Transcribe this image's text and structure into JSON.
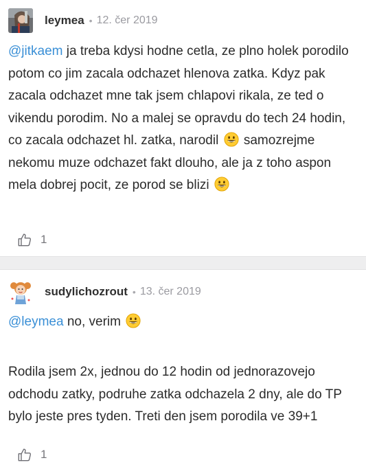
{
  "posts": [
    {
      "username": "leymea",
      "separator": "•",
      "date": "12. čer 2019",
      "mention": "@jitkaem",
      "text_part1": " ja treba kdysi hodne cetla, ze plno holek porodilo potom co jim zacala odchazet hlenova zatka. Kdyz pak zacala odchazet mne tak jsem chlapovi rikala, ze ted o vikendu porodim. No a malej se opravdu do tech 24 hodin, co zacala odchazet hl. zatka, narodil",
      "text_part2": " samozrejme nekomu muze odchazet fakt dlouho, ale ja z toho aspon mela dobrej pocit, ze porod se blizi",
      "like_count": "1",
      "icons": {
        "avatar": "user-photo-avatar",
        "emoji": "grinning-face-emoji",
        "like": "thumbs-up-icon"
      }
    },
    {
      "username": "sudylichozrout",
      "separator": "•",
      "date": "13. čer 2019",
      "mention": "@leymea",
      "text_part1": " no, verim",
      "paragraph2": "Rodila jsem 2x, jednou do 12 hodin od jednorazovejo odchodu zatky, podruhe zatka odchazela 2 dny, ale do TP bylo jeste pres tyden. Treti den jsem porodila ve 39+1",
      "like_count": "1",
      "icons": {
        "avatar": "cartoon-girl-avatar",
        "emoji": "grinning-face-emoji",
        "like": "thumbs-up-icon"
      }
    }
  ],
  "colors": {
    "mention": "#3a8fd6",
    "divider": "#eeeeef",
    "date": "#9a9aa0",
    "text": "#2b2b2b"
  }
}
